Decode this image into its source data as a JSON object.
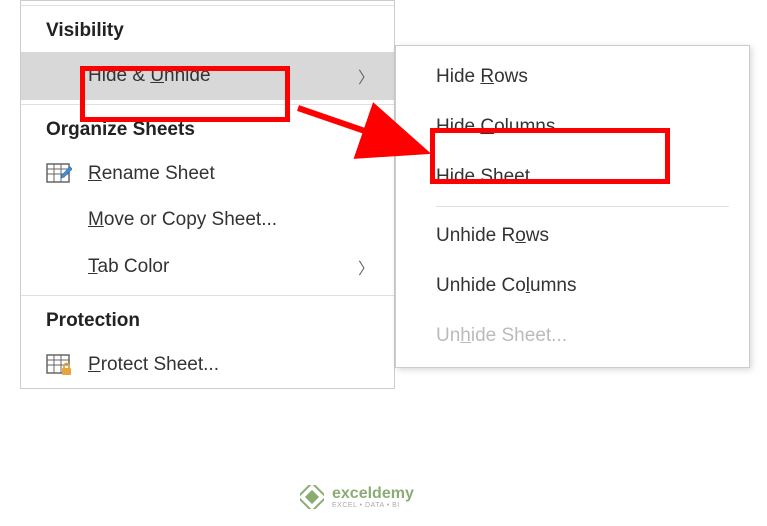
{
  "main_menu": {
    "sections": {
      "visibility": {
        "header": "Visibility",
        "hide_unhide": {
          "prefix": "Hide & ",
          "u": "U",
          "suffix": "nhide"
        }
      },
      "organize": {
        "header": "Organize Sheets",
        "rename": {
          "u": "R",
          "suffix": "ename Sheet"
        },
        "move_copy": {
          "u": "M",
          "suffix": "ove or Copy Sheet..."
        },
        "tab_color": {
          "u": "T",
          "suffix": "ab Color"
        }
      },
      "protection": {
        "header": "Protection",
        "protect": {
          "u": "P",
          "suffix": "rotect Sheet..."
        }
      }
    }
  },
  "submenu": {
    "hide_rows": {
      "prefix": "Hide ",
      "u": "R",
      "suffix": "ows"
    },
    "hide_columns": {
      "prefix": "Hide ",
      "u": "C",
      "suffix": "olumns"
    },
    "hide_sheet": {
      "prefix": "Hide ",
      "u": "S",
      "suffix": "heet"
    },
    "unhide_rows": {
      "prefix": "Unhide R",
      "u": "o",
      "suffix": "ws"
    },
    "unhide_columns": {
      "prefix": "Unhide Co",
      "u": "l",
      "suffix": "umns"
    },
    "unhide_sheet": {
      "prefix": "Un",
      "u": "h",
      "suffix": "ide Sheet..."
    }
  },
  "watermark": {
    "brand": "exceldemy",
    "tagline": "EXCEL • DATA • BI"
  }
}
